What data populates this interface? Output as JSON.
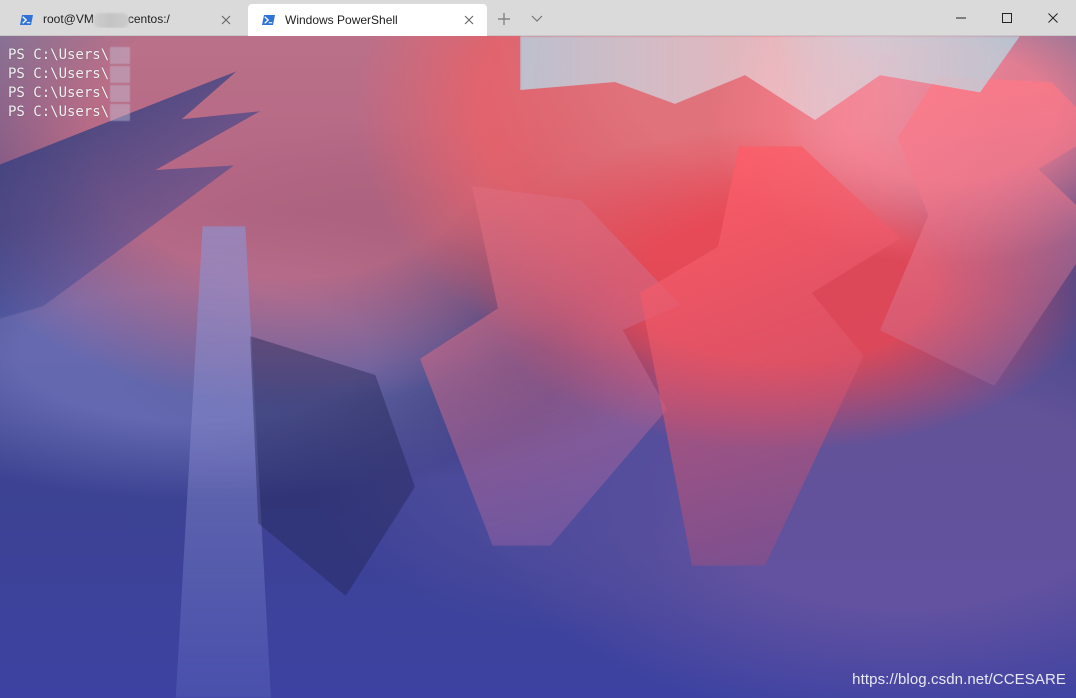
{
  "window": {
    "tabs": [
      {
        "title_prefix": "root@VM",
        "title_suffix": "centos:/",
        "close_label": "×"
      },
      {
        "title": "Windows PowerShell",
        "close_label": "×"
      }
    ],
    "actions": {
      "new_tab_label": "+",
      "dropdown_label": "⌄"
    },
    "controls": {
      "minimize_label": "—",
      "maximize_label": "□",
      "close_label": "×"
    }
  },
  "terminal": {
    "lines": [
      "PS C:\\Users\\",
      "PS C:\\Users\\",
      "PS C:\\Users\\",
      "PS C:\\Users\\"
    ],
    "watermark": "https://blog.csdn.net/CCESARE"
  },
  "icons": {
    "powershell_tab_icon": "powershell-icon",
    "close_tab_icon": "close-icon",
    "new_tab_icon": "plus-icon",
    "dropdown_icon": "chevron-down-icon",
    "minimize_icon": "minimize-icon",
    "maximize_icon": "maximize-icon",
    "window_close_icon": "close-icon"
  },
  "colors": {
    "titlebar": "#dadada",
    "active_tab": "#ffffff",
    "powershell_icon": "#2f73d9",
    "terminal_text": "#f3f3f3",
    "watermark": "#ffffff"
  }
}
